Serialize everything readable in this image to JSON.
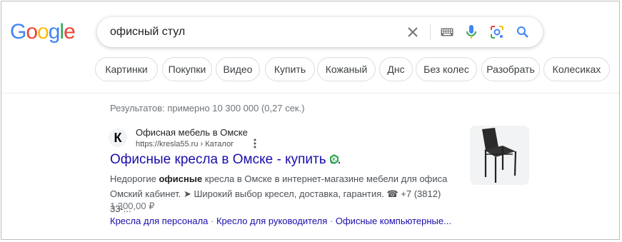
{
  "logo": {
    "text": "Google",
    "letters": [
      "G",
      "o",
      "o",
      "g",
      "l",
      "e"
    ],
    "colors": [
      "#4285f4",
      "#ea4335",
      "#fbbc05",
      "#4285f4",
      "#34a853",
      "#ea4335"
    ]
  },
  "search": {
    "query": "офисный стул",
    "icons": [
      "close-icon",
      "keyboard-icon",
      "mic-icon",
      "lens-icon",
      "search-icon"
    ]
  },
  "chips": [
    "Картинки",
    "Покупки",
    "Видео",
    "Купить",
    "Кожаный",
    "Днс",
    "Без колес",
    "Разобрать",
    "Колесиках"
  ],
  "results_stats": "Результатов: примерно 10 300 000 (0,27 сек.)",
  "result": {
    "favicon_letter": "К",
    "site_name": "Офисная мебель в Омске",
    "url": "https://kresla55.ru › Каталог",
    "title": "Офисные кресла в Омске - купить ...",
    "badge_letter": "K",
    "snippet_line1_pre": "Недорогие ",
    "snippet_line1_bold": "офисные",
    "snippet_line1_post": " кресла в Омске в интернет-магазине мебели для офиса",
    "snippet_line2": "Омский кабинет. ➤ Широкий выбор кресел, доставка, гарантия. ☎ +7 (3812) 33-...",
    "price": "1 300,00 ₽",
    "sitelinks": [
      "Кресла для персонала",
      "Кресло для руководителя",
      "Офисные компьютерные..."
    ],
    "sitelink_sep": " · "
  },
  "colors": {
    "link": "#1a0dab",
    "text": "#4d5156",
    "badge": "#34a853"
  }
}
